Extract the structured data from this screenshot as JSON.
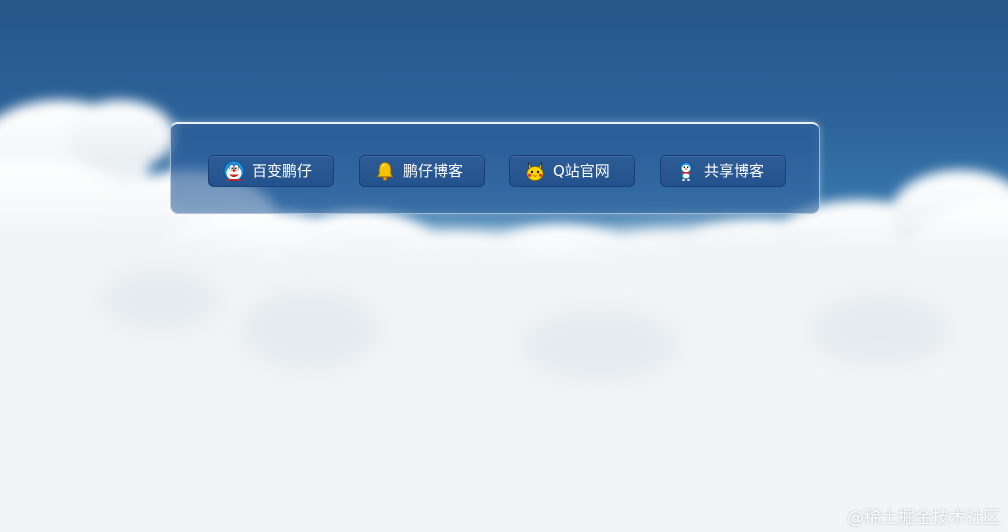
{
  "background": {
    "sky_top": "#27568a",
    "cloud_color": "#f3f5f6"
  },
  "nav": {
    "items": [
      {
        "label": "百变鹏仔",
        "icon": "doraemon-icon"
      },
      {
        "label": "鹏仔博客",
        "icon": "bell-icon"
      },
      {
        "label": "Q站官网",
        "icon": "pikachu-icon"
      },
      {
        "label": "共享博客",
        "icon": "robot-icon"
      }
    ]
  },
  "watermark": {
    "text": "@稀土掘金技术社区"
  },
  "colors": {
    "button_bg": "#23528c",
    "button_text": "#ffffff",
    "panel_border": "#ffffff"
  }
}
